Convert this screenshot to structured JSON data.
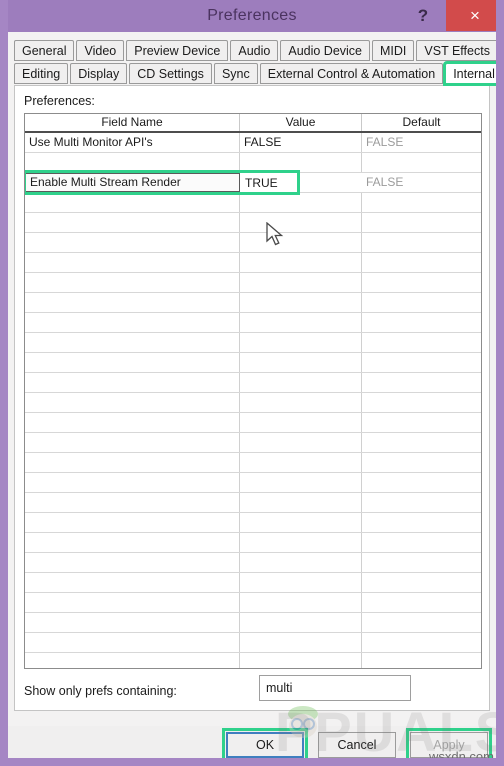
{
  "window": {
    "title": "Preferences",
    "help_label": "?",
    "close_label": "×",
    "titlebar_color": "#9d7dbd",
    "close_color": "#d24b4b",
    "highlight_color": "#2fd18b"
  },
  "tabs": {
    "row1": [
      {
        "label": "General",
        "active": false,
        "marked": false
      },
      {
        "label": "Video",
        "active": false,
        "marked": false
      },
      {
        "label": "Preview Device",
        "active": false,
        "marked": false
      },
      {
        "label": "Audio",
        "active": false,
        "marked": false
      },
      {
        "label": "Audio Device",
        "active": false,
        "marked": false
      },
      {
        "label": "MIDI",
        "active": false,
        "marked": false
      },
      {
        "label": "VST Effects",
        "active": false,
        "marked": false
      }
    ],
    "row2": [
      {
        "label": "Editing",
        "active": false,
        "marked": false
      },
      {
        "label": "Display",
        "active": false,
        "marked": false
      },
      {
        "label": "CD Settings",
        "active": false,
        "marked": false
      },
      {
        "label": "Sync",
        "active": false,
        "marked": false
      },
      {
        "label": "External Control & Automation",
        "active": false,
        "marked": false
      },
      {
        "label": "Internal",
        "active": true,
        "marked": true
      }
    ]
  },
  "panel": {
    "prefs_label": "Preferences:",
    "filter_label": "Show only prefs containing:",
    "filter_value": "multi",
    "filter_placeholder": ""
  },
  "grid": {
    "columns": [
      "Field Name",
      "Value",
      "Default"
    ],
    "rows": [
      {
        "field": "Use Multi Monitor API's",
        "value": "FALSE",
        "default": "FALSE",
        "selected": false
      },
      {
        "field": "",
        "value": "",
        "default": "",
        "selected": false
      },
      {
        "field": "Enable Multi Stream Render",
        "value": "TRUE",
        "default": "FALSE",
        "selected": true
      },
      {
        "field": "",
        "value": "",
        "default": "",
        "selected": false
      },
      {
        "field": "",
        "value": "",
        "default": "",
        "selected": false
      },
      {
        "field": "",
        "value": "",
        "default": "",
        "selected": false
      },
      {
        "field": "",
        "value": "",
        "default": "",
        "selected": false
      },
      {
        "field": "",
        "value": "",
        "default": "",
        "selected": false
      },
      {
        "field": "",
        "value": "",
        "default": "",
        "selected": false
      },
      {
        "field": "",
        "value": "",
        "default": "",
        "selected": false
      },
      {
        "field": "",
        "value": "",
        "default": "",
        "selected": false
      },
      {
        "field": "",
        "value": "",
        "default": "",
        "selected": false
      },
      {
        "field": "",
        "value": "",
        "default": "",
        "selected": false
      },
      {
        "field": "",
        "value": "",
        "default": "",
        "selected": false
      },
      {
        "field": "",
        "value": "",
        "default": "",
        "selected": false
      },
      {
        "field": "",
        "value": "",
        "default": "",
        "selected": false
      },
      {
        "field": "",
        "value": "",
        "default": "",
        "selected": false
      },
      {
        "field": "",
        "value": "",
        "default": "",
        "selected": false
      },
      {
        "field": "",
        "value": "",
        "default": "",
        "selected": false
      },
      {
        "field": "",
        "value": "",
        "default": "",
        "selected": false
      },
      {
        "field": "",
        "value": "",
        "default": "",
        "selected": false
      },
      {
        "field": "",
        "value": "",
        "default": "",
        "selected": false
      },
      {
        "field": "",
        "value": "",
        "default": "",
        "selected": false
      },
      {
        "field": "",
        "value": "",
        "default": "",
        "selected": false
      },
      {
        "field": "",
        "value": "",
        "default": "",
        "selected": false
      },
      {
        "field": "",
        "value": "",
        "default": "",
        "selected": false
      },
      {
        "field": "",
        "value": "",
        "default": "",
        "selected": false
      }
    ]
  },
  "buttons": {
    "ok": "OK",
    "cancel": "Cancel",
    "apply": "Apply"
  },
  "watermark": {
    "text": "PPUALS",
    "source": "wsxdn.com"
  }
}
